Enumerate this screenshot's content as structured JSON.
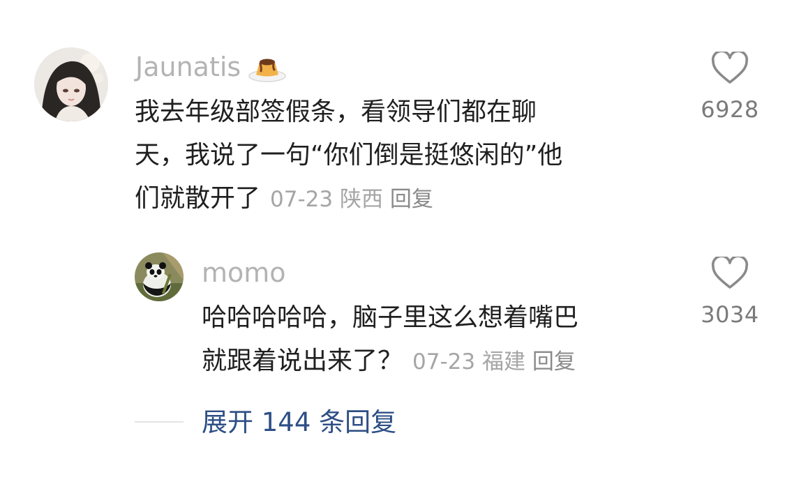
{
  "comment": {
    "username": "Jaunatis",
    "badge_icon": "pudding-icon",
    "avatar_icon": "anime-girl-avatar",
    "text_lines": [
      "我去年级部签假条，看领导们都在聊",
      "天，我说了一句“你们倒是挺悠闲的”他",
      "们就散开了"
    ],
    "date": "07-23",
    "location": "陕西",
    "reply_label": "回复",
    "likes": "6928",
    "like_icon": "heart-outline-icon"
  },
  "reply": {
    "username": "momo",
    "avatar_icon": "panda-avatar",
    "text_lines": [
      "哈哈哈哈哈，脑子里这么想着嘴巴",
      "就跟着说出来了？"
    ],
    "date": "07-23",
    "location": "福建",
    "reply_label": "回复",
    "likes": "3034",
    "like_icon": "heart-outline-icon"
  },
  "expand": {
    "label": "展开 144 条回复"
  },
  "colors": {
    "username": "#b3b3b3",
    "text": "#1f1f1f",
    "meta": "#a5a5a5",
    "link": "#2e4f85"
  }
}
